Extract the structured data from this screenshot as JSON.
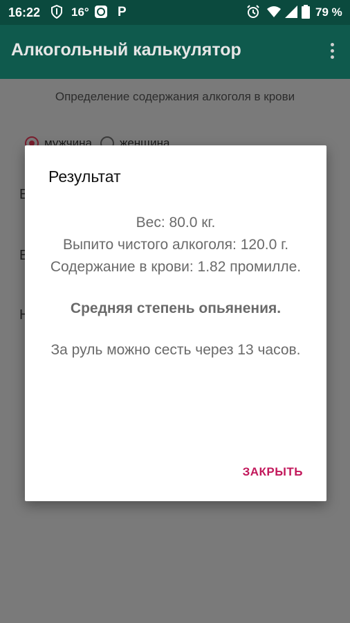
{
  "status_bar": {
    "time": "16:22",
    "temperature": "16°",
    "parking": "P",
    "battery": "79 %"
  },
  "app_bar": {
    "title": "Алкогольный калькулятор"
  },
  "background": {
    "subtitle": "Определение содержания алкоголя в крови",
    "gender_male": "мужчина",
    "gender_female": "женщина",
    "selected_gender": "мужчина",
    "row_letters": [
      "В",
      "В",
      "Н"
    ]
  },
  "dialog": {
    "title": "Результат",
    "weight": "Вес: 80.0 кг.",
    "alcohol": "Выпито чистого алкоголя: 120.0 г.",
    "blood": "Содержание в крови: 1.82 промилле.",
    "degree": "Средняя степень опьянения.",
    "drive": "За руль можно сесть через 13 часов.",
    "close_label": "ЗАКРЫТЬ"
  },
  "colors": {
    "status_bar": "#0b4a3e",
    "app_bar": "#0f5a4d",
    "accent": "#c2185b"
  }
}
